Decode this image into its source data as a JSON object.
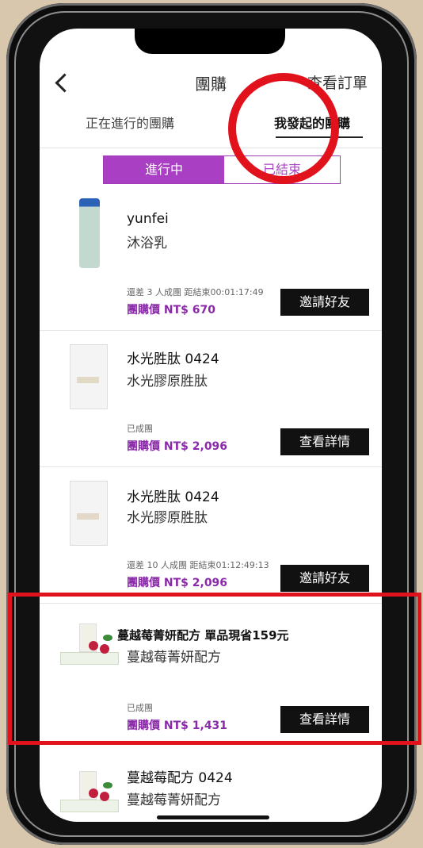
{
  "header": {
    "title": "團購",
    "orders_link": "查看訂單"
  },
  "tabs": {
    "ongoing": "正在進行的團購",
    "mine": "我發起的團購"
  },
  "segment": {
    "active": "進行中",
    "ended": "已結束"
  },
  "items": [
    {
      "name": "yunfei",
      "sub": "沐浴乳",
      "status_prefix": "還差 3 人成團  距結束",
      "countdown": "00:01:17:49",
      "price": "團購價 NT$ 670",
      "button": "邀請好友"
    },
    {
      "name": "水光胜肽 0424",
      "sub": "水光膠原胜肽",
      "status_prefix": "已成團",
      "countdown": "",
      "price": "團購價 NT$ 2,096",
      "button": "查看詳情"
    },
    {
      "name": "水光胜肽 0424",
      "sub": "水光膠原胜肽",
      "status_prefix": "還差 10 人成團  距結束",
      "countdown": "01:12:49:13",
      "price": "團購價 NT$ 2,096",
      "button": "邀請好友"
    },
    {
      "name": "蔓越莓菁妍配方 單品現省159元",
      "sub": "蔓越莓菁妍配方",
      "status_prefix": "已成團",
      "countdown": "",
      "price": "團購價 NT$ 1,431",
      "button": "查看詳情"
    },
    {
      "name": "蔓越莓配方 0424",
      "sub": "蔓越莓菁妍配方"
    }
  ],
  "colors": {
    "accent": "#a93fc3",
    "highlight": "#e1121c"
  }
}
